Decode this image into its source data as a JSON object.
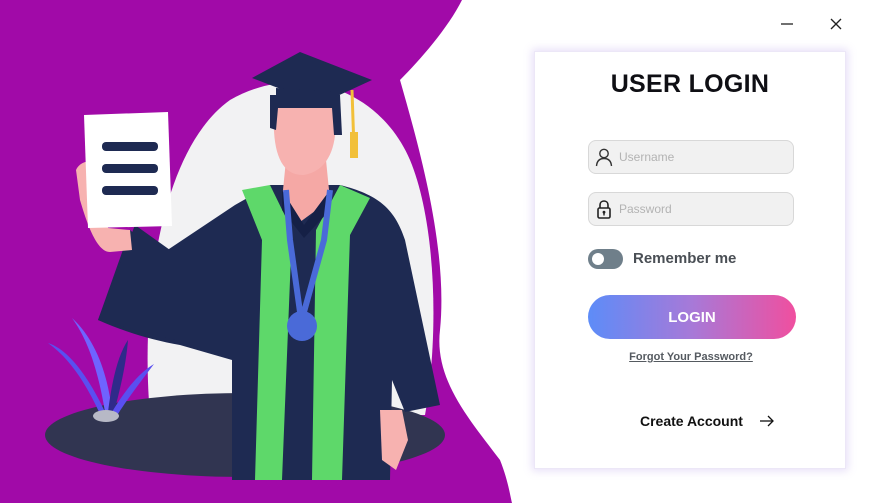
{
  "window": {
    "controls": {
      "minimize_icon": "minimize-icon",
      "close_icon": "close-icon"
    }
  },
  "colors": {
    "brand_purple": "#a10aa8",
    "navy": "#1e2a52",
    "green": "#5ed86a",
    "gradient_start": "#5d8cf8",
    "gradient_end": "#f04f9f"
  },
  "illustration": {
    "subject": "graduate-holding-document",
    "icons": [
      "graduation-cap-icon",
      "medal-icon",
      "document-icon",
      "plant-icon"
    ]
  },
  "login": {
    "title": "USER LOGIN",
    "username": {
      "placeholder": "Username",
      "value": "",
      "icon": "user-icon"
    },
    "password": {
      "placeholder": "Password",
      "value": "",
      "icon": "lock-icon"
    },
    "remember": {
      "label": "Remember me",
      "checked": false
    },
    "login_button": "LOGIN",
    "forgot_password": "Forgot Your Password?",
    "create_account": "Create Account",
    "create_account_icon": "arrow-right-icon"
  }
}
